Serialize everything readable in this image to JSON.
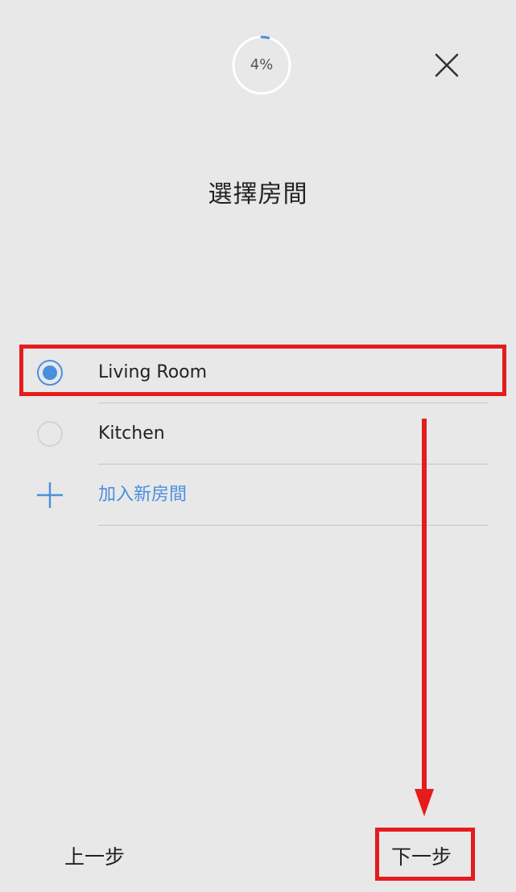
{
  "header": {
    "progress_percent": 4,
    "progress_text": "4%",
    "close_icon": "close-icon"
  },
  "title": "選擇房間",
  "rooms": [
    {
      "label": "Living Room",
      "selected": true
    },
    {
      "label": "Kitchen",
      "selected": false
    }
  ],
  "add_room": {
    "label": "加入新房間",
    "icon": "plus-icon"
  },
  "footer": {
    "back_label": "上一步",
    "next_label": "下一步"
  },
  "colors": {
    "accent": "#4a8fde",
    "annotation": "#e51c1c",
    "background": "#e8e8e8"
  }
}
